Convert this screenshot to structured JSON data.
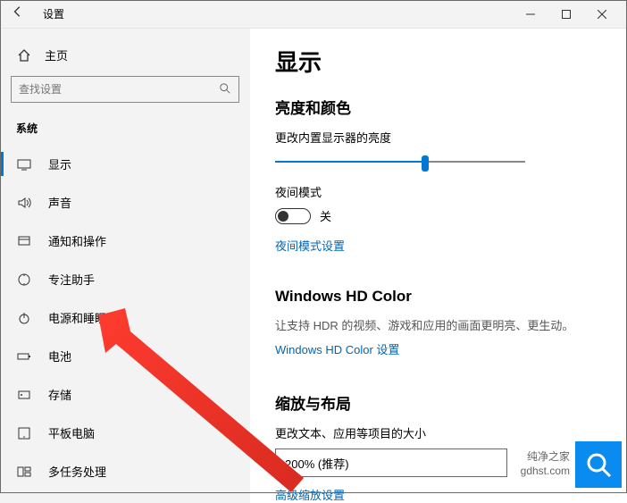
{
  "window": {
    "title": "设置"
  },
  "sidebar": {
    "home_label": "主页",
    "search_placeholder": "查找设置",
    "section": "系统",
    "items": [
      {
        "label": "显示",
        "icon": "display"
      },
      {
        "label": "声音",
        "icon": "sound"
      },
      {
        "label": "通知和操作",
        "icon": "notification"
      },
      {
        "label": "专注助手",
        "icon": "focus"
      },
      {
        "label": "电源和睡眠",
        "icon": "power"
      },
      {
        "label": "电池",
        "icon": "battery"
      },
      {
        "label": "存储",
        "icon": "storage"
      },
      {
        "label": "平板电脑",
        "icon": "tablet"
      },
      {
        "label": "多任务处理",
        "icon": "multitask"
      }
    ]
  },
  "content": {
    "page_title": "显示",
    "brightness_section": "亮度和颜色",
    "brightness_label": "更改内置显示器的亮度",
    "brightness_value_pct": 60,
    "night_mode_label": "夜间模式",
    "night_mode_state": "关",
    "night_mode_link": "夜间模式设置",
    "hdr_section": "Windows HD Color",
    "hdr_desc": "让支持 HDR 的视频、游戏和应用的画面更明亮、更生动。",
    "hdr_link": "Windows HD Color 设置",
    "scale_section": "缩放与布局",
    "scale_label": "更改文本、应用等项目的大小",
    "scale_value": "200% (推荐)",
    "scale_link": "高级缩放设置"
  },
  "watermark": {
    "line1": "纯净之家",
    "line2": "gdhst.com"
  },
  "colors": {
    "accent": "#0078d4",
    "link": "#0066b4"
  }
}
